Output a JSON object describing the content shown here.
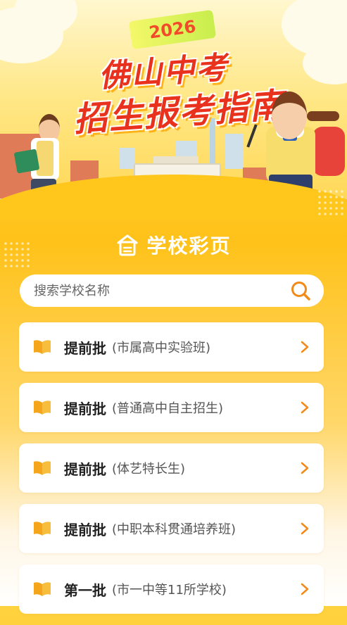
{
  "banner": {
    "year": "2026",
    "title_line1": "佛山中考",
    "title_line2": "招生报考指南"
  },
  "section": {
    "title": "学校彩页",
    "icon": "school-icon"
  },
  "search": {
    "placeholder": "搜索学校名称",
    "value": "",
    "icon": "search-icon"
  },
  "list": {
    "items": [
      {
        "title": "提前批",
        "subtitle": "(市属高中实验班)"
      },
      {
        "title": "提前批",
        "subtitle": "(普通高中自主招生)"
      },
      {
        "title": "提前批",
        "subtitle": "(体艺特长生)"
      },
      {
        "title": "提前批",
        "subtitle": "(中职本科贯通培养班)"
      },
      {
        "title": "第一批",
        "subtitle": "(市一中等11所学校)"
      }
    ]
  },
  "colors": {
    "accent": "#ffc21a",
    "title_red": "#e8321e",
    "icon_orange": "#f2a01e"
  }
}
